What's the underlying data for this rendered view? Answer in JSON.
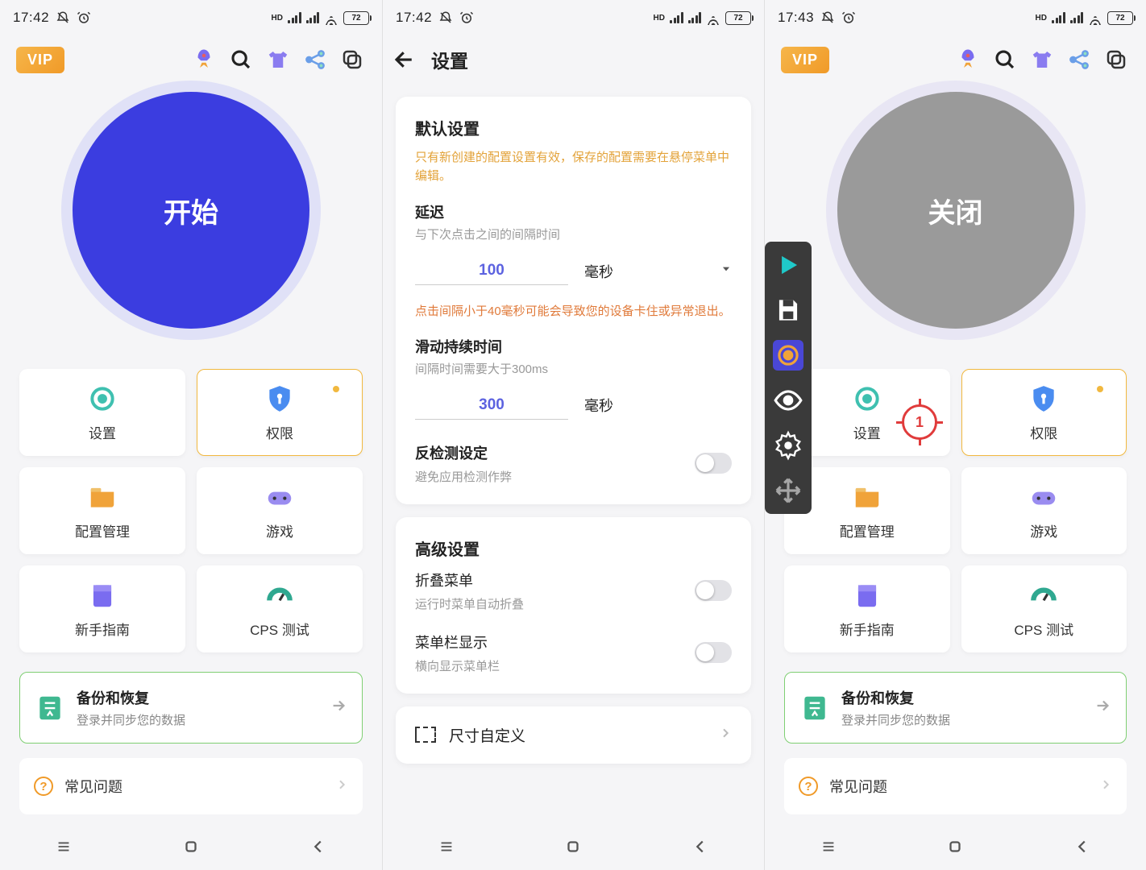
{
  "status": {
    "time1": "17:42",
    "time2": "17:42",
    "time3": "17:43",
    "battery": "72",
    "hd": "HD"
  },
  "toolbar": {
    "vip": "VIP"
  },
  "s1": {
    "button": "开始",
    "cards": [
      {
        "label": "设置"
      },
      {
        "label": "权限"
      },
      {
        "label": "配置管理"
      },
      {
        "label": "游戏"
      },
      {
        "label": "新手指南"
      },
      {
        "label": "CPS 测试"
      }
    ],
    "backup": {
      "title": "备份和恢复",
      "sub": "登录并同步您的数据"
    },
    "faq": "常见问题"
  },
  "s2": {
    "title": "设置",
    "sec1": {
      "title": "默认设置",
      "warn": "只有新创建的配置设置有效，保存的配置需要在悬停菜单中编辑。",
      "delay": {
        "title": "延迟",
        "sub": "与下次点击之间的间隔时间",
        "value": "100",
        "unit": "毫秒"
      },
      "warn2": "点击间隔小于40毫秒可能会导致您的设备卡住或异常退出。",
      "swipe": {
        "title": "滑动持续时间",
        "sub": "间隔时间需要大于300ms",
        "value": "300",
        "unit": "毫秒"
      },
      "antidetect": {
        "title": "反检测设定",
        "sub": "避免应用检测作弊"
      }
    },
    "sec2": {
      "title": "高级设置",
      "fold": {
        "title": "折叠菜单",
        "sub": "运行时菜单自动折叠"
      },
      "bar": {
        "title": "菜单栏显示",
        "sub": "横向显示菜单栏"
      }
    },
    "sec3": {
      "size": "尺寸自定义"
    }
  },
  "s3": {
    "button": "关闭",
    "target": "1"
  }
}
